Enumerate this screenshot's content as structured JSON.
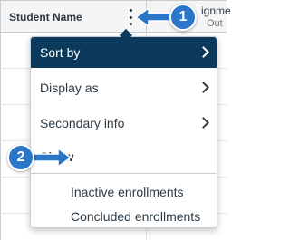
{
  "gradebook": {
    "column_header": "Student Name",
    "assignment_title": "ignme",
    "assignment_subtitle": "Out"
  },
  "menu": {
    "items": [
      {
        "label": "Sort by",
        "has_submenu": true,
        "active": true
      },
      {
        "label": "Display as",
        "has_submenu": true,
        "active": false
      },
      {
        "label": "Secondary info",
        "has_submenu": true,
        "active": false
      }
    ],
    "section_title": "Show",
    "show_options": [
      {
        "label": "Inactive enrollments"
      },
      {
        "label": "Concluded enrollments"
      }
    ]
  },
  "callouts": {
    "one": "1",
    "two": "2",
    "color": "#2a77c9"
  },
  "colors": {
    "menu_active_bg": "#0b3a5c",
    "text": "#2d3b45"
  }
}
